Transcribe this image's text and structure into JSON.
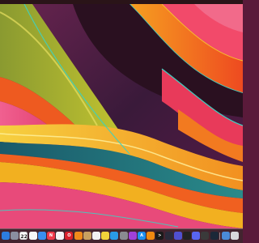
{
  "desktop": {
    "colors": {
      "menubar": "#2a1418",
      "accent_orange": "#f47a1a",
      "accent_magenta": "#c21870",
      "accent_teal": "#3fb8b0",
      "accent_yellow": "#f2c21a"
    }
  },
  "dock": {
    "calendar": {
      "month": "",
      "day": "22"
    },
    "apps": [
      {
        "name": "finder-icon",
        "bg": "#2c7de0",
        "glyph": ""
      },
      {
        "name": "launchpad-icon",
        "bg": "#8a8fa0",
        "glyph": ""
      },
      {
        "name": "calendar-icon",
        "bg": "#ffffff",
        "glyph": ""
      },
      {
        "name": "photos-icon",
        "bg": "#f7f7f7",
        "glyph": ""
      },
      {
        "name": "mail-icon",
        "bg": "#3a8ef0",
        "glyph": ""
      },
      {
        "name": "news-icon",
        "bg": "#f03a4a",
        "glyph": "N"
      },
      {
        "name": "chrome-icon",
        "bg": "#f4f4f4",
        "glyph": ""
      },
      {
        "name": "opera-icon",
        "bg": "#d8202a",
        "glyph": "O"
      },
      {
        "name": "books-icon",
        "bg": "#f08a1a",
        "glyph": ""
      },
      {
        "name": "preview-icon",
        "bg": "#c8a060",
        "glyph": ""
      },
      {
        "name": "reminders-icon",
        "bg": "#f2f2f2",
        "glyph": ""
      },
      {
        "name": "pencil-icon",
        "bg": "#f2d23a",
        "glyph": ""
      },
      {
        "name": "safari-icon",
        "bg": "#2a9be8",
        "glyph": ""
      },
      {
        "name": "settings-icon",
        "bg": "#8a8a90",
        "glyph": ""
      },
      {
        "name": "podcasts-icon",
        "bg": "#a040d8",
        "glyph": ""
      },
      {
        "name": "app-store-icon",
        "bg": "#1e90f0",
        "glyph": "A"
      },
      {
        "name": "vlc-icon",
        "bg": "#f08a10",
        "glyph": ""
      },
      {
        "name": "terminal-icon",
        "bg": "#1a1a1a",
        "glyph": ">"
      },
      {
        "name": "dark-app-icon",
        "bg": "#2a2a3a",
        "glyph": ""
      },
      {
        "name": "shortcuts-icon",
        "bg": "#5050d0",
        "glyph": ""
      },
      {
        "name": "ableton-icon",
        "bg": "#222222",
        "glyph": ""
      },
      {
        "name": "discord-icon",
        "bg": "#5865f2",
        "glyph": ""
      },
      {
        "name": "dark-app-2-icon",
        "bg": "#3a3a3a",
        "glyph": ""
      },
      {
        "name": "steam-icon",
        "bg": "#1b2838",
        "glyph": ""
      },
      {
        "name": "downloads-icon",
        "bg": "#4a8ad8",
        "glyph": ""
      },
      {
        "name": "trash-icon",
        "bg": "#d8d8dc",
        "glyph": ""
      }
    ]
  }
}
